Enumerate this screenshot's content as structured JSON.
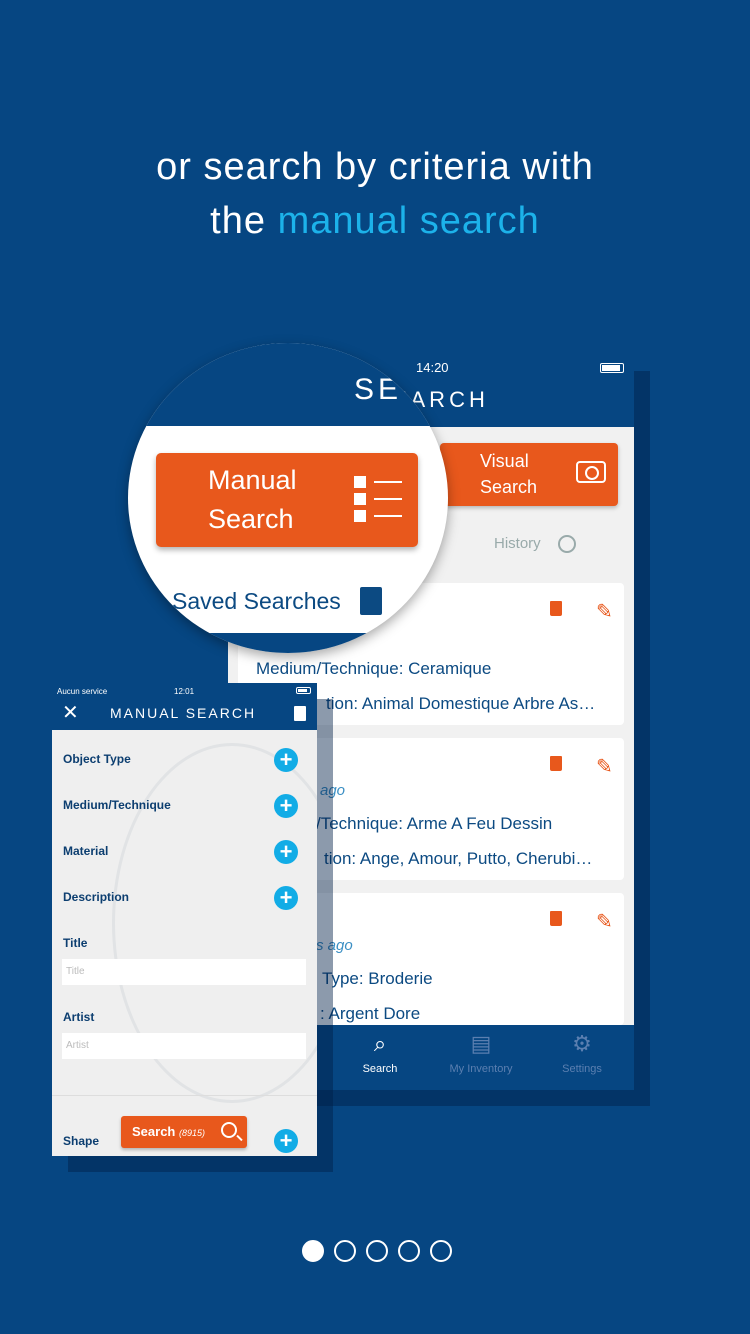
{
  "headline": {
    "line1": "or search by criteria with",
    "line2_prefix": "the ",
    "line2_accent": "manual search"
  },
  "colors": {
    "background": "#064682",
    "accent_text": "#1cb2ea",
    "orange": "#e8581c",
    "plus": "#12ace6"
  },
  "back_screen": {
    "time": "14:20",
    "title": "SEARCH",
    "visual_search": "Visual Search",
    "history": "History",
    "cards": [
      {
        "lines": [
          "Medium/Technique: Ceramique",
          "tion: Animal Domestique Arbre As…"
        ]
      },
      {
        "ago": "ago",
        "lines": [
          "/Technique: Arme A Feu Dessin",
          "tion: Ange, Amour, Putto, Cherubi…"
        ]
      },
      {
        "ago": "s ago",
        "lines": [
          "Type: Broderie",
          ": Argent Dore"
        ]
      }
    ],
    "tabs": [
      {
        "label": "Search",
        "icon": "search-icon"
      },
      {
        "label": "My Inventory",
        "icon": "archive-box-icon"
      },
      {
        "label": "Settings",
        "icon": "gear-icon"
      }
    ]
  },
  "magnifier": {
    "title": "SE",
    "manual_search": "Manual Search",
    "saved_searches": "Saved Searches"
  },
  "front_screen": {
    "carrier": "Aucun service",
    "time": "12:01",
    "title": "MANUAL SEARCH",
    "fields": [
      "Object Type",
      "Medium/Technique",
      "Material",
      "Description"
    ],
    "title_label": "Title",
    "title_placeholder": "Title",
    "artist_label": "Artist",
    "artist_placeholder": "Artist",
    "shape_label": "Shape",
    "search_button": "Search",
    "search_count": "(8915)"
  },
  "pagination": {
    "total": 5,
    "active": 1
  }
}
